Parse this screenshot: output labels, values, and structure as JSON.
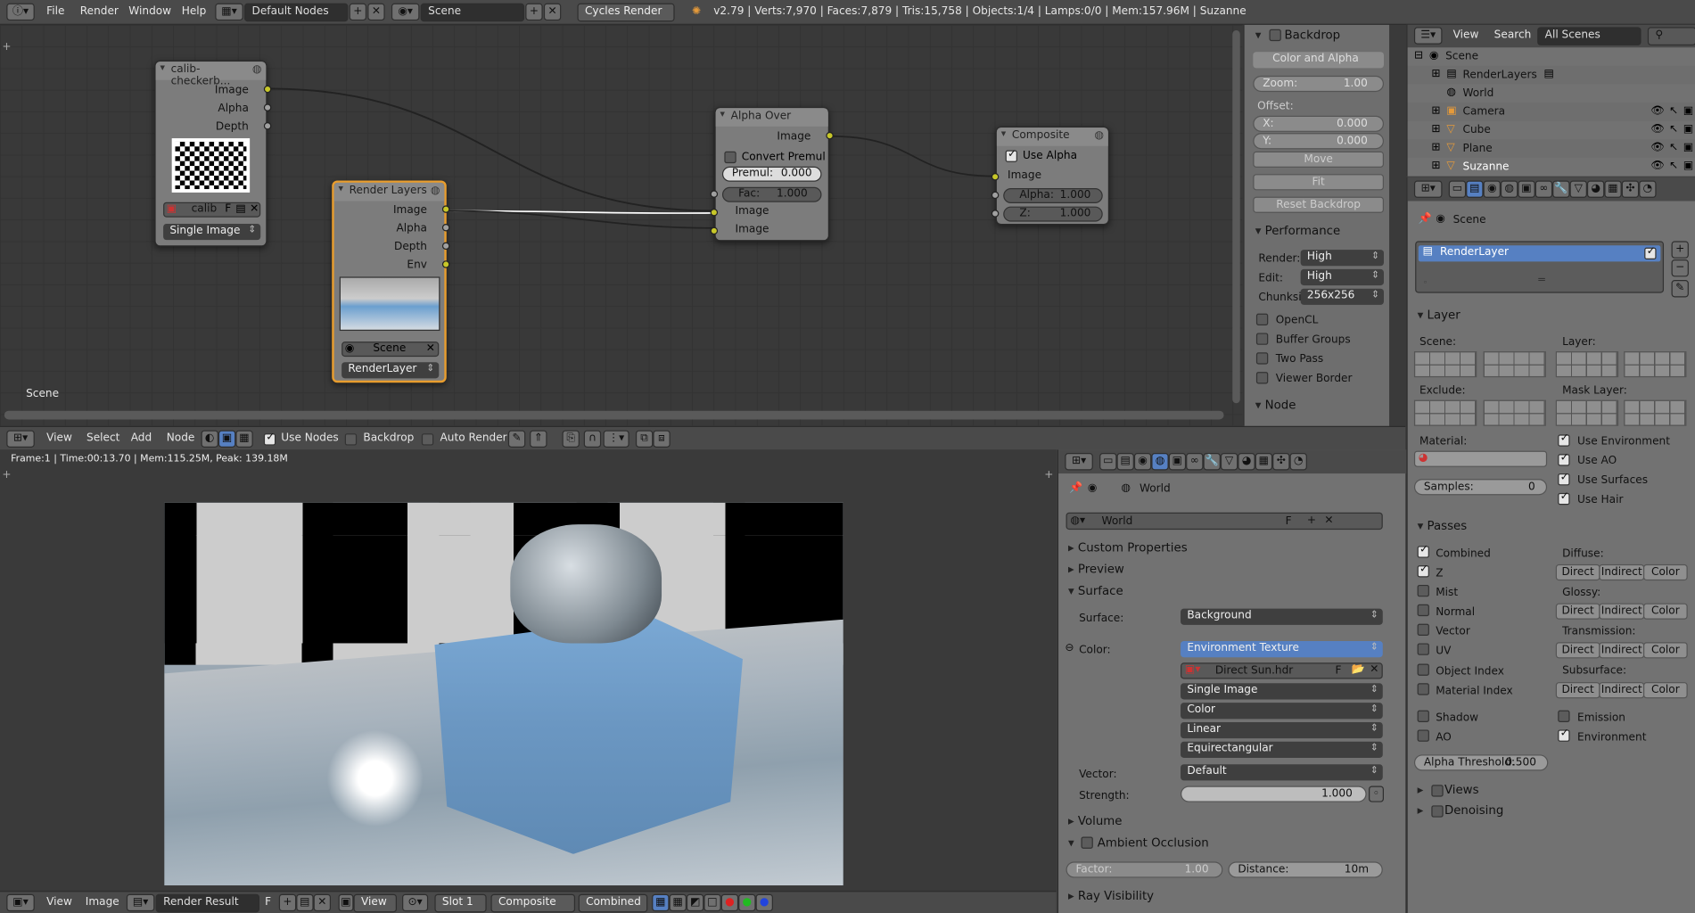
{
  "topbar": {
    "menus": [
      "File",
      "Render",
      "Window",
      "Help"
    ],
    "screen_layout": "Default Nodes",
    "scene": "Scene",
    "engine": "Cycles Render",
    "stats": "v2.79 | Verts:7,970 | Faces:7,879 | Tris:15,758 | Objects:1/4 | Lamps:0/0 | Mem:157.96M | Suzanne"
  },
  "node_editor": {
    "label": "Scene",
    "nodes": {
      "image": {
        "title": "calib-checkerb...",
        "outputs": [
          "Image",
          "Alpha",
          "Depth"
        ],
        "image_name": "calib",
        "f_label": "F",
        "source": "Single Image"
      },
      "render_layers": {
        "title": "Render Layers",
        "outputs": [
          "Image",
          "Alpha",
          "Depth",
          "Env"
        ],
        "scene": "Scene",
        "layer": "RenderLayer"
      },
      "alpha_over": {
        "title": "Alpha Over",
        "output": "Image",
        "convert_premul": "Convert Premul",
        "premul_label": "Premul:",
        "premul_value": "0.000",
        "fac_label": "Fac:",
        "fac_value": "1.000",
        "inputs": [
          "Image",
          "Image"
        ]
      },
      "composite": {
        "title": "Composite",
        "use_alpha": "Use Alpha",
        "input": "Image",
        "alpha_label": "Alpha:",
        "alpha_value": "1.000",
        "z_label": "Z:",
        "z_value": "1.000"
      }
    },
    "header": {
      "menus": [
        "View",
        "Select",
        "Add",
        "Node"
      ],
      "use_nodes": "Use Nodes",
      "backdrop": "Backdrop",
      "auto_render": "Auto Render"
    }
  },
  "backdrop_panel": {
    "title": "Backdrop",
    "channels": "Color and Alpha",
    "zoom_label": "Zoom:",
    "zoom_value": "1.00",
    "offset_label": "Offset:",
    "x_label": "X:",
    "x_value": "0.000",
    "y_label": "Y:",
    "y_value": "0.000",
    "move": "Move",
    "fit": "Fit",
    "reset": "Reset Backdrop",
    "performance": "Performance",
    "render_label": "Render:",
    "render_value": "High",
    "edit_label": "Edit:",
    "edit_value": "High",
    "chunk_label": "Chunksi",
    "chunk_value": "256x256",
    "opencl": "OpenCL",
    "buffer_groups": "Buffer Groups",
    "two_pass": "Two Pass",
    "viewer_border": "Viewer Border",
    "node": "Node"
  },
  "image_editor": {
    "status": "Frame:1 | Time:00:13.70 | Mem:115.25M, Peak: 139.18M",
    "header": {
      "menus": [
        "View",
        "Image"
      ],
      "image": "Render Result",
      "f_label": "F",
      "view": "View",
      "slot": "Slot 1",
      "pass_layer": "Composite",
      "pass": "Combined"
    }
  },
  "world_props": {
    "context": "World",
    "world_name": "World",
    "f_label": "F",
    "custom_properties": "Custom Properties",
    "preview": "Preview",
    "surface": "Surface",
    "surface_label": "Surface:",
    "surface_value": "Background",
    "color_label": "Color:",
    "color_value": "Environment Texture",
    "image": "Direct Sun.hdr",
    "image_f": "F",
    "source": "Single Image",
    "colorspace": "Color",
    "interp": "Linear",
    "projection": "Equirectangular",
    "vector_label": "Vector:",
    "vector_value": "Default",
    "strength_label": "Strength:",
    "strength_value": "1.000",
    "volume": "Volume",
    "ambient_occlusion": "Ambient Occlusion",
    "factor_label": "Factor:",
    "factor_value": "1.00",
    "distance_label": "Distance:",
    "distance_value": "10m",
    "ray_visibility": "Ray Visibility"
  },
  "outliner": {
    "menus": [
      "View",
      "Search"
    ],
    "filter": "All Scenes",
    "items": [
      "Scene",
      "RenderLayers",
      "World",
      "Camera",
      "Cube",
      "Plane",
      "Suzanne"
    ]
  },
  "layer_props": {
    "context": "Scene",
    "render_layer": "RenderLayer",
    "layer": "Layer",
    "scene_label": "Scene:",
    "layer_label": "Layer:",
    "exclude_label": "Exclude:",
    "mask_layer_label": "Mask Layer:",
    "material_label": "Material:",
    "samples_label": "Samples:",
    "samples_value": "0",
    "use_environment": "Use Environment",
    "use_ao": "Use AO",
    "use_surfaces": "Use Surfaces",
    "use_hair": "Use Hair",
    "passes": "Passes",
    "combined": "Combined",
    "z": "Z",
    "mist": "Mist",
    "normal": "Normal",
    "vector": "Vector",
    "uv": "UV",
    "object_index": "Object Index",
    "material_index": "Material Index",
    "shadow": "Shadow",
    "ao": "AO",
    "diffuse": "Diffuse:",
    "glossy": "Glossy:",
    "transmission": "Transmission:",
    "subsurface": "Subsurface:",
    "direct": "Direct",
    "indirect": "Indirect",
    "color": "Color",
    "emission": "Emission",
    "environment": "Environment",
    "alpha_threshold_label": "Alpha Threshold:",
    "alpha_threshold_value": "0.500",
    "views": "Views",
    "denoising": "Denoising"
  }
}
